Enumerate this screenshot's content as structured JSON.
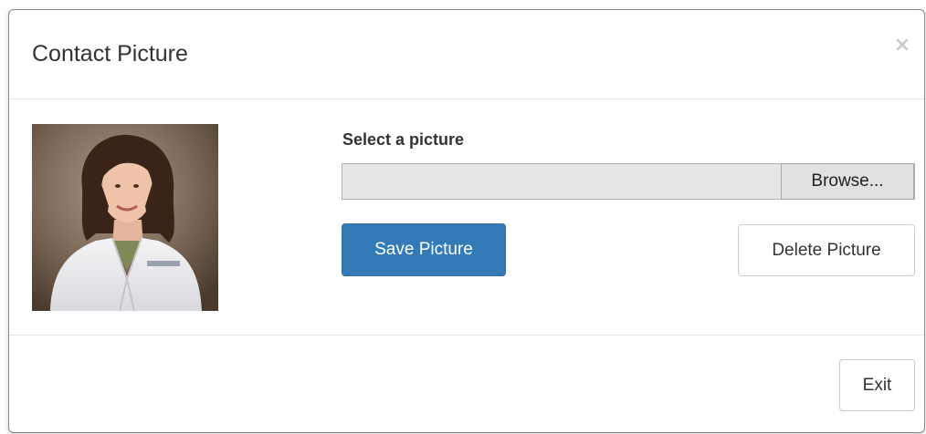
{
  "modal": {
    "title": "Contact Picture",
    "close_glyph": "×"
  },
  "photo": {
    "description_icon": "contact-photo"
  },
  "form": {
    "label": "Select a picture",
    "file_value": "",
    "browse_label": "Browse..."
  },
  "actions": {
    "save_label": "Save Picture",
    "delete_label": "Delete Picture"
  },
  "footer": {
    "exit_label": "Exit"
  },
  "colors": {
    "primary": "#337ab7",
    "primary_border": "#2e6da4",
    "text": "#333333"
  }
}
